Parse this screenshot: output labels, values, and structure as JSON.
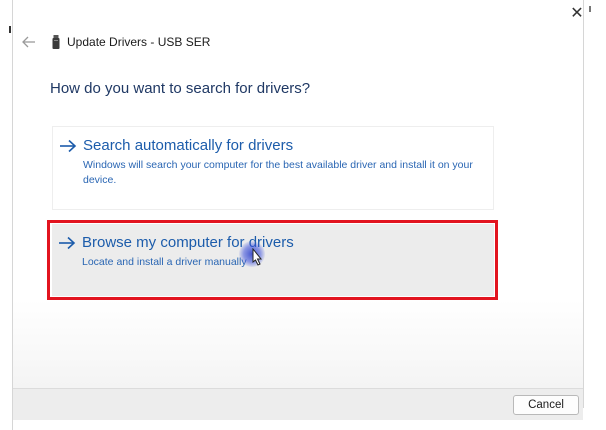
{
  "window": {
    "title": "Update Drivers - USB SER",
    "close_glyph": "✕",
    "back_icon": "back-arrow-icon",
    "device_icon": "usb-device-icon"
  },
  "main": {
    "heading": "How do you want to search for drivers?",
    "options": [
      {
        "title": "Search automatically for drivers",
        "description": "Windows will search your computer for the best available driver and install it on your device.",
        "icon": "right-arrow-icon"
      },
      {
        "title": "Browse my computer for drivers",
        "description": "Locate and install a driver manually",
        "icon": "right-arrow-icon",
        "state": "hovered"
      }
    ]
  },
  "footer": {
    "cancel_label": "Cancel"
  },
  "colors": {
    "accent": "#1c5cab",
    "highlight_box": "#e2141f",
    "heading": "#1f3864"
  }
}
